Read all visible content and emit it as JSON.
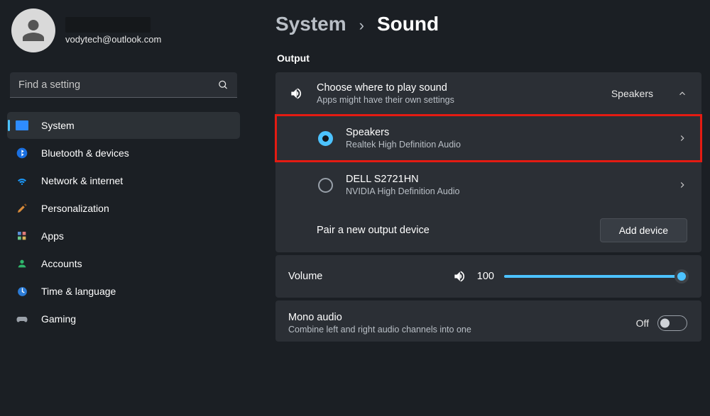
{
  "profile": {
    "email": "vodytech@outlook.com"
  },
  "search": {
    "placeholder": "Find a setting"
  },
  "nav": {
    "items": [
      {
        "label": "System"
      },
      {
        "label": "Bluetooth & devices"
      },
      {
        "label": "Network & internet"
      },
      {
        "label": "Personalization"
      },
      {
        "label": "Apps"
      },
      {
        "label": "Accounts"
      },
      {
        "label": "Time & language"
      },
      {
        "label": "Gaming"
      }
    ]
  },
  "breadcrumb": {
    "parent": "System",
    "sep": "›",
    "current": "Sound"
  },
  "section_output": "Output",
  "output_header": {
    "title": "Choose where to play sound",
    "sub": "Apps might have their own settings",
    "value": "Speakers"
  },
  "devices": [
    {
      "name": "Speakers",
      "sub": "Realtek High Definition Audio",
      "selected": true,
      "highlighted": true
    },
    {
      "name": "DELL S2721HN",
      "sub": "NVIDIA High Definition Audio",
      "selected": false,
      "highlighted": false
    }
  ],
  "pair": {
    "label": "Pair a new output device",
    "button": "Add device"
  },
  "volume": {
    "label": "Volume",
    "value": "100"
  },
  "mono": {
    "title": "Mono audio",
    "sub": "Combine left and right audio channels into one",
    "state": "Off"
  }
}
